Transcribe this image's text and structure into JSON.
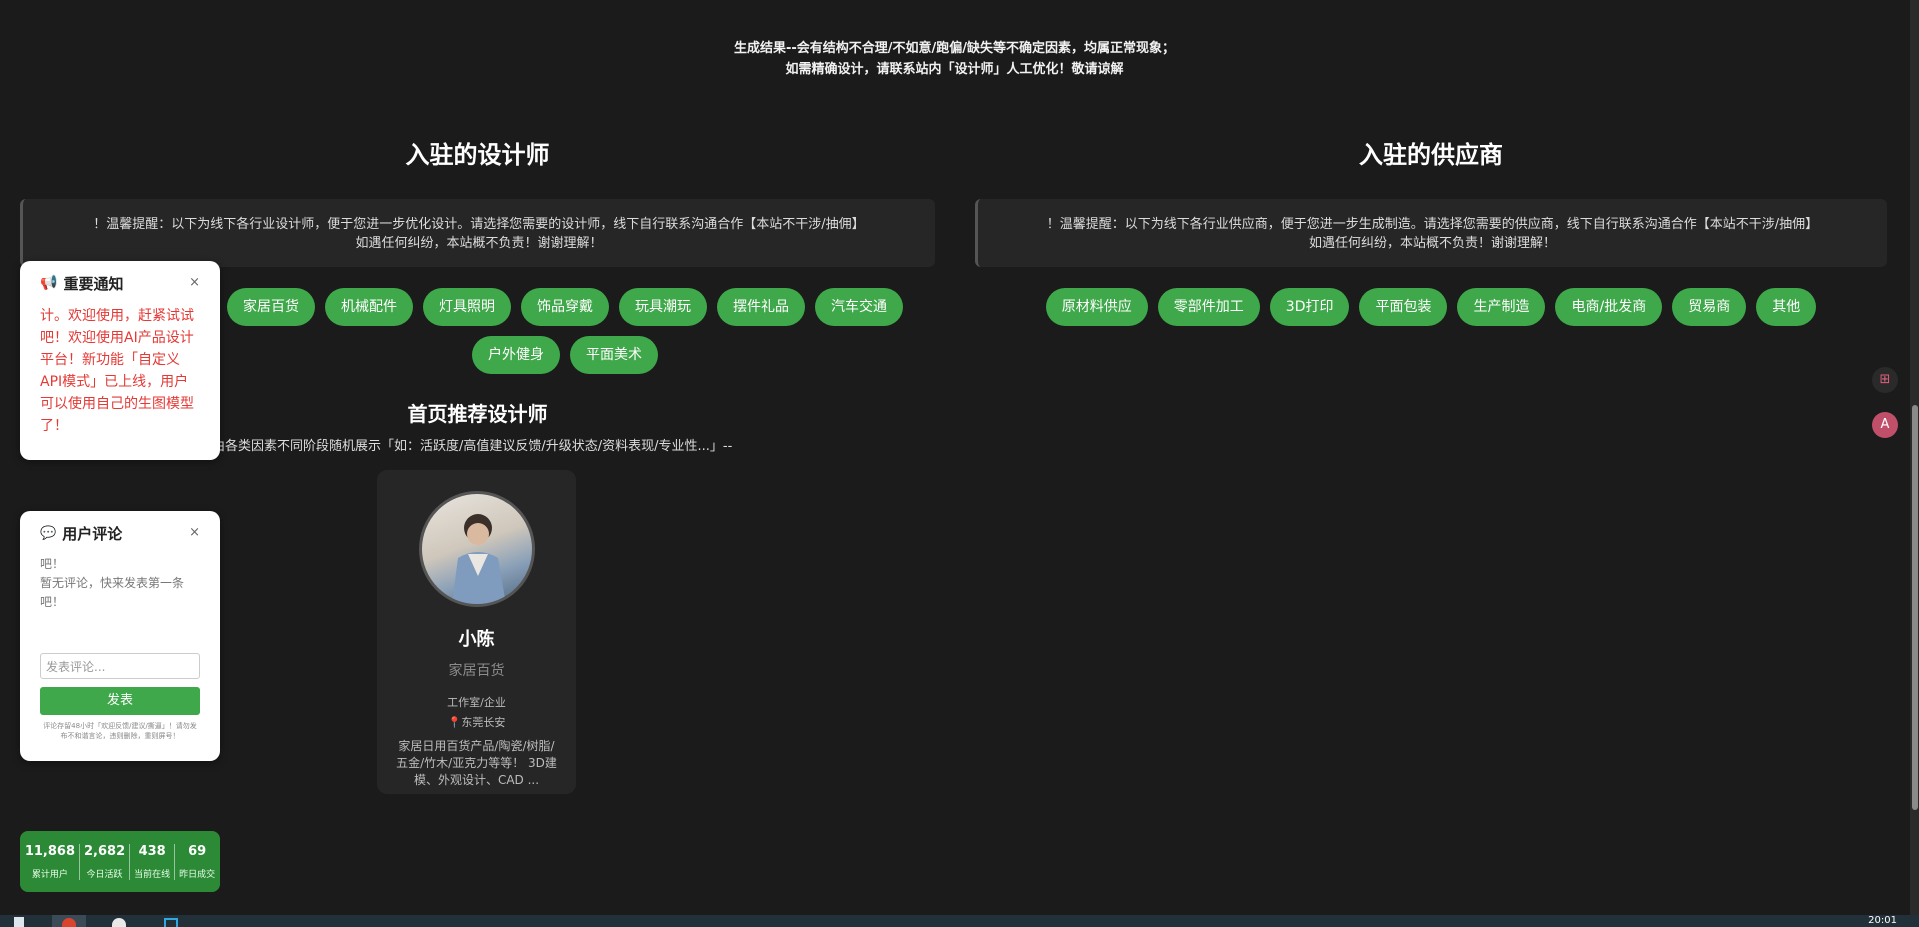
{
  "top_notice": {
    "line1": "生成结果--会有结构不合理/不如意/跑偏/缺失等不确定因素，均属正常现象；",
    "line2": "如需精确设计，请联系站内「设计师」人工优化！敬请谅解"
  },
  "designers": {
    "title": "入驻的设计师",
    "tip_line1": "！温馨提醒：以下为线下各行业设计师，便于您进一步优化设计。请选择您需要的设计师，线下自行联系沟通合作【本站不干涉/抽佣】",
    "tip_line2": "如遇任何纠纷，本站概不负责！谢谢理解！",
    "tags": [
      "家居百货",
      "机械配件",
      "灯具照明",
      "饰品穿戴",
      "玩具潮玩",
      "摆件礼品",
      "汽车交通",
      "户外健身",
      "平面美术"
    ]
  },
  "suppliers": {
    "title": "入驻的供应商",
    "tip_line1": "！温馨提醒：以下为线下各行业供应商，便于您进一步生成制造。请选择您需要的供应商，线下自行联系沟通合作【本站不干涉/抽佣】",
    "tip_line2": "如遇任何纠纷，本站概不负责！谢谢理解！",
    "tags": [
      "原材料供应",
      "零部件加工",
      "3D打印",
      "平面包装",
      "生产制造",
      "电商/批发商",
      "贸易商",
      "其他"
    ]
  },
  "recommend": {
    "title": "首页推荐设计师",
    "subtitle": "由各类因素不同阶段随机展示「如：活跃度/高值建议反馈/升级状态/资料表现/专业性...」--",
    "card": {
      "name": "小陈",
      "category": "家居百货",
      "type": "工作室/企业",
      "location": "📍东莞长安",
      "description": "家居日用百货产品/陶瓷/树脂/五金/竹木/亚克力等等！ 3D建模、外观设计、CAD ..."
    }
  },
  "notify_panel": {
    "title": "重要通知",
    "close": "×",
    "body": "计。欢迎使用，赶紧试试吧！欢迎使用AI产品设计平台！新功能「自定义API模式」已上线，用户可以使用自己的生图模型了！"
  },
  "comment_panel": {
    "title": "用户评论",
    "close": "×",
    "body_line1": "吧！",
    "body_line2": "暂无评论，快来发表第一条吧！",
    "input_placeholder": "发表评论...",
    "submit": "发表",
    "note": "评论存留48小时「欢迎反馈/建议/撕逼」！请勿发布不和谐言论，违则删除，重则屏号！"
  },
  "stats": [
    {
      "value": "11,868",
      "label": "累计用户"
    },
    {
      "value": "2,682",
      "label": "今日活跃"
    },
    {
      "value": "438",
      "label": "当前在线"
    },
    {
      "value": "69",
      "label": "昨日成交"
    }
  ],
  "taskbar": {
    "clock": "20:01"
  }
}
